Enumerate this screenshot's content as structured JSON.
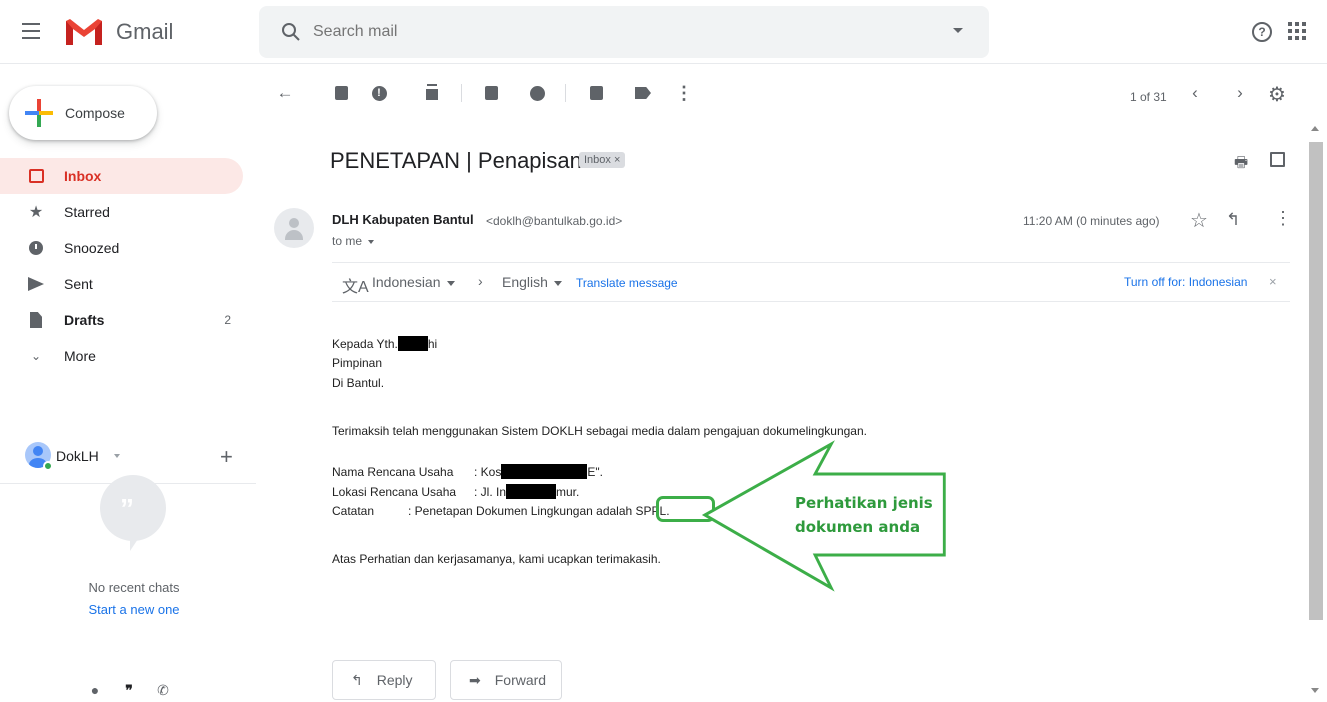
{
  "app": {
    "name": "Gmail"
  },
  "search": {
    "placeholder": "Search mail"
  },
  "compose": {
    "label": "Compose"
  },
  "nav": {
    "items": [
      {
        "label": "Inbox",
        "icon": "inbox-icon"
      },
      {
        "label": "Starred",
        "icon": "star-icon"
      },
      {
        "label": "Snoozed",
        "icon": "clock-icon"
      },
      {
        "label": "Sent",
        "icon": "send-icon"
      },
      {
        "label": "Drafts",
        "icon": "draft-icon",
        "count": "2"
      },
      {
        "label": "More",
        "icon": "chevron-down-icon"
      }
    ]
  },
  "account": {
    "name": "DokLH"
  },
  "hangouts": {
    "empty_text": "No recent chats",
    "start_link": "Start a new one"
  },
  "toolbar": {
    "pager": "1 of 31"
  },
  "email": {
    "subject": "PENETAPAN | Penapisan",
    "label_chip": "Inbox ×",
    "sender_name": "DLH Kabupaten Bantul",
    "sender_email": "<doklh@bantulkab.go.id>",
    "to": "to me",
    "timestamp": "11:20 AM (0 minutes ago)",
    "body": {
      "line1a": "Kepada Yth.",
      "line1b": "hi",
      "line2": "Pimpinan",
      "line3": "Di Bantul.",
      "line4a": "Terimaksih telah menggunakan Sistem DOKLH sebagai media dalam pengajuan dokume",
      "line4b": "lingkungan.",
      "nama_label": "Nama Rencana Usaha",
      "nama_value_a": ": Kos",
      "nama_value_b": "E\".",
      "lokasi_label": "Lokasi Rencana Usaha",
      "lokasi_value_a": ": Jl. In",
      "lokasi_value_b": "mur.",
      "catatan_label": "Catatan",
      "catatan_value": ": Penetapan Dokumen Lingkungan adalah",
      "catatan_doc": "SPPL.",
      "closing": "Atas Perhatian dan kerjasamanya, kami ucapkan terimakasih."
    }
  },
  "translate": {
    "from": "Indonesian",
    "to": "English",
    "link": "Translate message",
    "turn_off": "Turn off for: Indonesian",
    "close": "×"
  },
  "annotation": {
    "line1": "Perhatikan jenis",
    "line2": "dokumen anda",
    "color": "#3cae48"
  },
  "buttons": {
    "reply": "Reply",
    "forward": "Forward"
  },
  "colors": {
    "accent_red": "#d93025",
    "link_blue": "#1a73e8",
    "inbox_highlight": "#fce8e6"
  }
}
